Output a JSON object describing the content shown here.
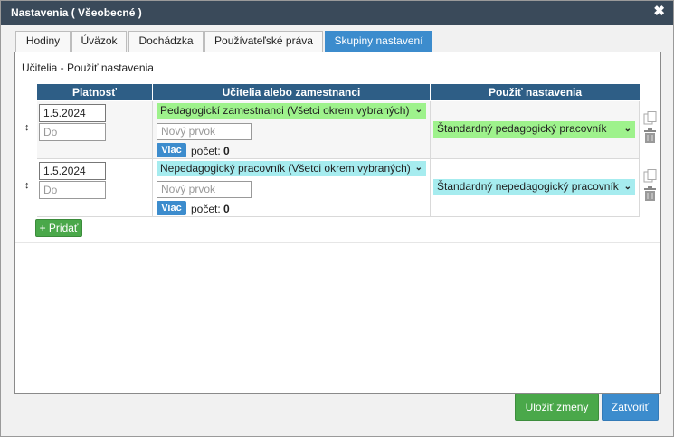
{
  "dialog": {
    "title": "Nastavenia ( Všeobecné )",
    "close_symbol": "✖"
  },
  "tabs": [
    {
      "label": "Hodiny"
    },
    {
      "label": "Úväzok"
    },
    {
      "label": "Dochádzka"
    },
    {
      "label": "Používateľské práva"
    },
    {
      "label": "Skupiny nastavení",
      "active": true
    }
  ],
  "section": {
    "title": "Učitelia - Použiť nastavenia"
  },
  "table": {
    "headers": [
      "Platnosť",
      "Učitelia alebo zamestnanci",
      "Použiť nastavenia"
    ],
    "rows": [
      {
        "valid_from": "1.5.2024",
        "valid_to_placeholder": "Do",
        "group": "Pedagogickí zamestnanci (Všetci okrem vybraných)",
        "new_item_placeholder": "Nový prvok",
        "more_label": "Viac",
        "count_label": "počet:",
        "count_value": "0",
        "setting": "Štandardný pedagogický pracovník"
      },
      {
        "valid_from": "1.5.2024",
        "valid_to_placeholder": "Do",
        "group": "Nepedagogický pracovník (Všetci okrem vybraných)",
        "new_item_placeholder": "Nový prvok",
        "more_label": "Viac",
        "count_label": "počet:",
        "count_value": "0",
        "setting": "Štandardný nepedagogický pracovník"
      }
    ]
  },
  "actions": {
    "add_label": "+ Pridať",
    "save_label": "Uložiť zmeny",
    "close_label": "Zatvoriť"
  },
  "icons": {
    "drag": "sort-arrows-icon",
    "copy": "copy-icon",
    "delete": "trash-icon",
    "dropdown": "chevron-down-icon"
  },
  "colors": {
    "titlebar": "#3a4a5a",
    "tab_active": "#3c8ccd",
    "header": "#2e5e86",
    "green_select": "#9ef28c",
    "cyan_select": "#a6ecef",
    "save": "#4aa84a",
    "close": "#3c8ccd"
  }
}
